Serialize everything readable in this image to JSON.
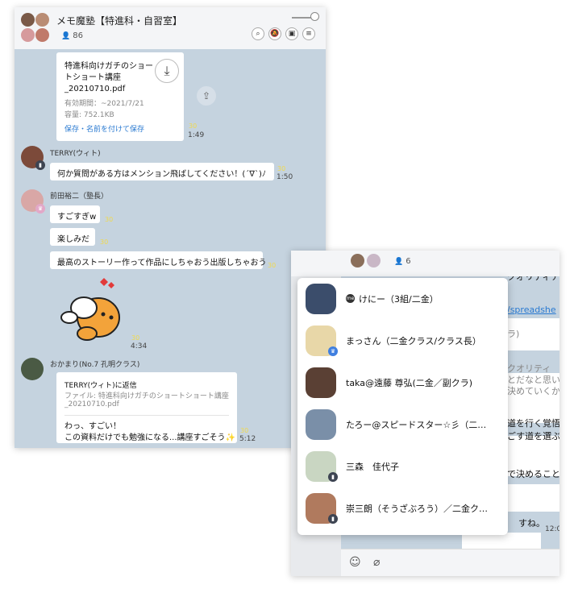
{
  "window1": {
    "title": "メモ魔塾【特進科・自習室】",
    "member_count": "86",
    "messages": {
      "file": {
        "name_lines": [
          "特進科向けガチのショー",
          "トショート講座",
          "_20210710.pdf"
        ],
        "expiry": "有効期間：~2021/7/21",
        "size": "容量: 752.1KB",
        "save_label": "保存・名前を付けて保存",
        "read": "30",
        "time": "1:49"
      },
      "terry": {
        "name": "TERRY(ウィト)",
        "text": "何か質問がある方はメンション飛ばしてください！(´∇`)ﾉ",
        "read": "30",
        "time": "1:50"
      },
      "maeda": {
        "name": "前田裕二（塾長）",
        "bubbles": [
          {
            "text": "すごすぎw",
            "read": "30"
          },
          {
            "text": "楽しみだ",
            "read": "30"
          },
          {
            "text": "最高のストーリー作って作品にしちゃおう出版しちゃおう",
            "read": "30"
          }
        ],
        "sticker_read": "30",
        "sticker_time": "4:34"
      },
      "okamari": {
        "name": "おかまり(No.7 孔明クラス)",
        "reply_to": "TERRY(ウィト)に返信",
        "reply_file_lines": [
          "ファイル: 特進科向けガチのショートショート講座",
          "_20210710.pdf"
        ],
        "text_lines": [
          "わっ、すごい！",
          "この資料だけでも勉強になる...講座すごそう✨"
        ],
        "read": "30",
        "time": "5:12"
      }
    }
  },
  "window2": {
    "member_count": "6",
    "background_texts": [
      "クオリティア",
      "/spreadshe",
      "ラ)",
      "クオリティ",
      "とだなと思い",
      "決めていくか",
      "道を行く覚悟",
      "ごす道を選ぶ",
      "で決めること",
      "すね。",
      "12:0"
    ],
    "members": [
      {
        "name": "けにー（3組/二金）",
        "badge": "me"
      },
      {
        "name": "まっさん（二金クラス/クラス長）",
        "badge": "crown"
      },
      {
        "name": "taka@遠藤 尊弘(二金／副クラ)",
        "badge": ""
      },
      {
        "name": "たろー@スピードスター☆彡（二…",
        "badge": ""
      },
      {
        "name": "三森　佳代子",
        "badge": "pc"
      },
      {
        "name": "崇三朗（そうざぶろう）／二金ク…",
        "badge": "pc"
      }
    ]
  },
  "colors": {
    "chat_bg": "#c5d3df",
    "read_mark": "#f0d94e",
    "link": "#2a7ad1"
  }
}
